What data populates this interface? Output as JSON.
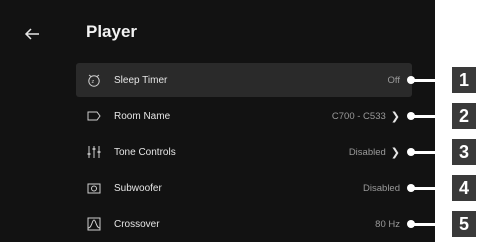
{
  "header": {
    "title": "Player",
    "back_icon": "arrow-left-icon"
  },
  "rows": [
    {
      "label": "Sleep Timer",
      "value": "Off",
      "icon": "sleep-timer-icon",
      "chevron": false,
      "selected": true,
      "callout": "1"
    },
    {
      "label": "Room Name",
      "value": "C700 - C533",
      "icon": "room-tag-icon",
      "chevron": true,
      "selected": false,
      "callout": "2"
    },
    {
      "label": "Tone Controls",
      "value": "Disabled",
      "icon": "sliders-icon",
      "chevron": true,
      "selected": false,
      "callout": "3"
    },
    {
      "label": "Subwoofer",
      "value": "Disabled",
      "icon": "subwoofer-icon",
      "chevron": false,
      "selected": false,
      "callout": "4"
    },
    {
      "label": "Crossover",
      "value": "80 Hz",
      "icon": "crossover-icon",
      "chevron": false,
      "selected": false,
      "callout": "5"
    }
  ],
  "colors": {
    "background": "#121212",
    "selected_row": "#2a2a2a",
    "badge": "#3a3a3a"
  }
}
